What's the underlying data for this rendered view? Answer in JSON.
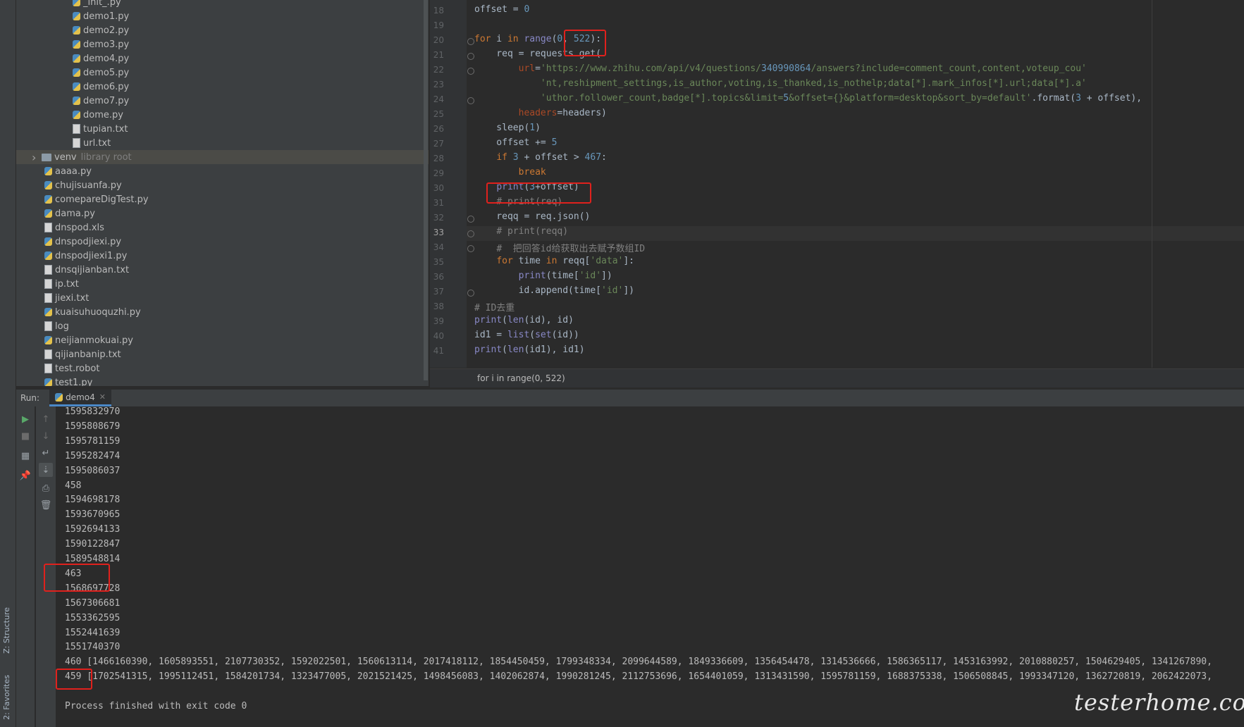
{
  "tool_windows": {
    "structure": "Z: Structure",
    "favorites": "2: Favorites"
  },
  "project_tree": {
    "items": [
      {
        "name": "_init_.py",
        "type": "py",
        "indent": 2
      },
      {
        "name": "demo1.py",
        "type": "py",
        "indent": 2
      },
      {
        "name": "demo2.py",
        "type": "py",
        "indent": 2
      },
      {
        "name": "demo3.py",
        "type": "py",
        "indent": 2
      },
      {
        "name": "demo4.py",
        "type": "py",
        "indent": 2
      },
      {
        "name": "demo5.py",
        "type": "py",
        "indent": 2
      },
      {
        "name": "demo6.py",
        "type": "py",
        "indent": 2
      },
      {
        "name": "demo7.py",
        "type": "py",
        "indent": 2
      },
      {
        "name": "dome.py",
        "type": "py",
        "indent": 2
      },
      {
        "name": "tupian.txt",
        "type": "txt",
        "indent": 2
      },
      {
        "name": "url.txt",
        "type": "txt",
        "indent": 2
      },
      {
        "name": "venv",
        "type": "folder",
        "indent": 0,
        "suffix": "library root",
        "selected": true
      },
      {
        "name": "aaaa.py",
        "type": "py",
        "indent": 1
      },
      {
        "name": "chujisuanfa.py",
        "type": "py",
        "indent": 1
      },
      {
        "name": "comepareDigTest.py",
        "type": "py",
        "indent": 1
      },
      {
        "name": "dama.py",
        "type": "py",
        "indent": 1
      },
      {
        "name": "dnspod.xls",
        "type": "txt",
        "indent": 1
      },
      {
        "name": "dnspodjiexi.py",
        "type": "py",
        "indent": 1
      },
      {
        "name": "dnspodjiexi1.py",
        "type": "py",
        "indent": 1
      },
      {
        "name": "dnsqijianban.txt",
        "type": "txt",
        "indent": 1
      },
      {
        "name": "ip.txt",
        "type": "txt",
        "indent": 1
      },
      {
        "name": "jiexi.txt",
        "type": "txt",
        "indent": 1
      },
      {
        "name": "kuaisuhuoquzhi.py",
        "type": "py",
        "indent": 1
      },
      {
        "name": "log",
        "type": "txt",
        "indent": 1
      },
      {
        "name": "neijianmokuai.py",
        "type": "py",
        "indent": 1
      },
      {
        "name": "qijianbanip.txt",
        "type": "txt",
        "indent": 1
      },
      {
        "name": "test.robot",
        "type": "txt",
        "indent": 1
      },
      {
        "name": "test1.py",
        "type": "py",
        "indent": 1
      }
    ]
  },
  "editor": {
    "line_numbers": [
      "18",
      "19",
      "20",
      "21",
      "22",
      "23",
      "24",
      "25",
      "26",
      "27",
      "28",
      "29",
      "30",
      "31",
      "32",
      "33",
      "34",
      "35",
      "36",
      "37",
      "38",
      "39",
      "40",
      "41"
    ],
    "current_line": "33",
    "code_lines": [
      "offset = 0",
      "",
      "for i in range(0, 522):",
      "    req = requests.get(",
      "        url='https://www.zhihu.com/api/v4/questions/340990864/answers?include=comment_count,content,voteup_cou'",
      "            'nt,reshipment_settings,is_author,voting,is_thanked,is_nothelp;data[*].mark_infos[*].url;data[*].a'",
      "            'uthor.follower_count,badge[*].topics&limit=5&offset={}&platform=desktop&sort_by=default'.format(3 + offset),",
      "        headers=headers)",
      "    sleep(1)",
      "    offset += 5",
      "    if 3 + offset > 467:",
      "        break",
      "    print(3+offset)",
      "    # print(req)",
      "    reqq = req.json()",
      "    # print(reqq)",
      "    #  把回答id给获取出去赋予数组ID",
      "    for time in reqq['data']:",
      "        print(time['id'])",
      "        id.append(time['id'])",
      "# ID去重",
      "print(len(id), id)",
      "id1 = list(set(id))",
      "print(len(id1), id1)"
    ],
    "breadcrumb": "for i in range(0, 522)"
  },
  "run_panel": {
    "label": "Run:",
    "tab_name": "demo4",
    "console_lines": [
      "1595832970",
      "1595808679",
      "1595781159",
      "1595282474",
      "1595086037",
      "458",
      "1594698178",
      "1593670965",
      "1592694133",
      "1590122847",
      "1589548814",
      "463",
      "1568697728",
      "1567306681",
      "1553362595",
      "1552441639",
      "1551740370",
      "460 [1466160390, 1605893551, 2107730352, 1592022501, 1560613114, 2017418112, 1854450459, 1799348334, 2099644589, 1849336609, 1356454478, 1314536666, 1586365117, 1453163992, 2010880257, 1504629405, 1341267890,",
      "459 [1702541315, 1995112451, 1584201734, 1323477005, 2021521425, 1498456083, 1402062874, 1990281245, 2112753696, 1654401059, 1313431590, 1595781159, 1688375338, 1506508845, 1993347120, 1362720819, 2062422073,",
      "",
      "Process finished with exit code 0"
    ]
  },
  "watermark": "testerhome.com",
  "colors": {
    "highlight_box": "#e0211d",
    "keyword": "#cc7832",
    "number": "#6897bb",
    "string": "#6a8759",
    "comment": "#808080"
  }
}
